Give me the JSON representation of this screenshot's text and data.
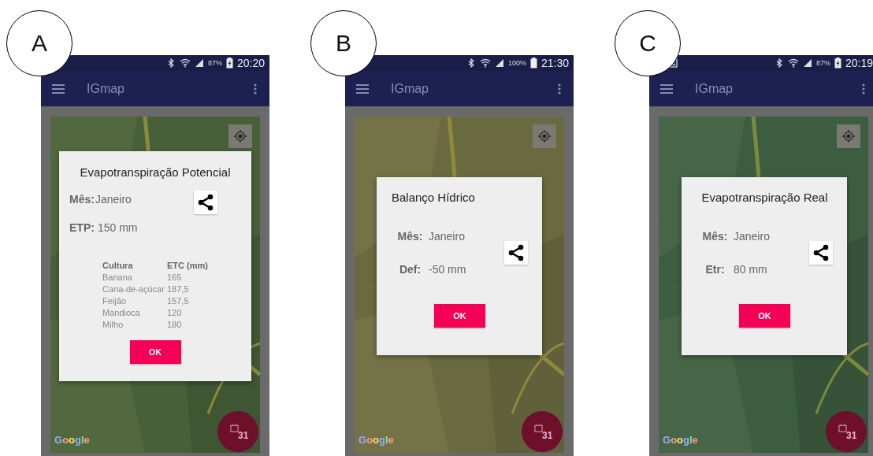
{
  "panels": [
    {
      "label": "A",
      "status": {
        "screenshot_notification": false,
        "battery": "87%",
        "charging": true,
        "time": "20:20"
      },
      "app_title": "IGmap",
      "dialog": {
        "kind": "compact",
        "title_centered": true,
        "title": "Evapotranspiração Potencial",
        "fields": [
          {
            "label": "Mês:",
            "value": "Janeiro"
          },
          {
            "label": "ETP:",
            "value": "150 mm"
          }
        ],
        "table": {
          "columns": [
            "Cultura",
            "ETC (mm)"
          ],
          "rows": [
            [
              "Banana",
              "165"
            ],
            [
              "Cana-de-açúcar",
              "187,5"
            ],
            [
              "Feijão",
              "157,5"
            ],
            [
              "Mandioca",
              "120"
            ],
            [
              "Milho",
              "180"
            ]
          ]
        },
        "button": "OK"
      },
      "map_logo": "Google",
      "fab_text": "31"
    },
    {
      "label": "B",
      "status": {
        "screenshot_notification": false,
        "battery": "100%",
        "charging": false,
        "time": "21:30"
      },
      "app_title": "IGmap",
      "dialog": {
        "kind": "spaced",
        "title_centered": false,
        "title": "Balanço Hídrico",
        "fields": [
          {
            "label": "Mês:",
            "value": "Janeiro"
          },
          {
            "label": "Def:",
            "value": "-50 mm"
          }
        ],
        "button": "OK"
      },
      "map_logo": "Google",
      "fab_text": "31"
    },
    {
      "label": "C",
      "status": {
        "screenshot_notification": true,
        "battery": "87%",
        "charging": true,
        "time": "20:19"
      },
      "app_title": "IGmap",
      "dialog": {
        "kind": "spaced",
        "title_centered": true,
        "title": "Evapotranspiração Real",
        "fields": [
          {
            "label": "Mês:",
            "value": "Janeiro"
          },
          {
            "label": "Etr:",
            "value": "80 mm"
          }
        ],
        "button": "OK"
      },
      "map_logo": "Google",
      "fab_text": "31"
    }
  ]
}
